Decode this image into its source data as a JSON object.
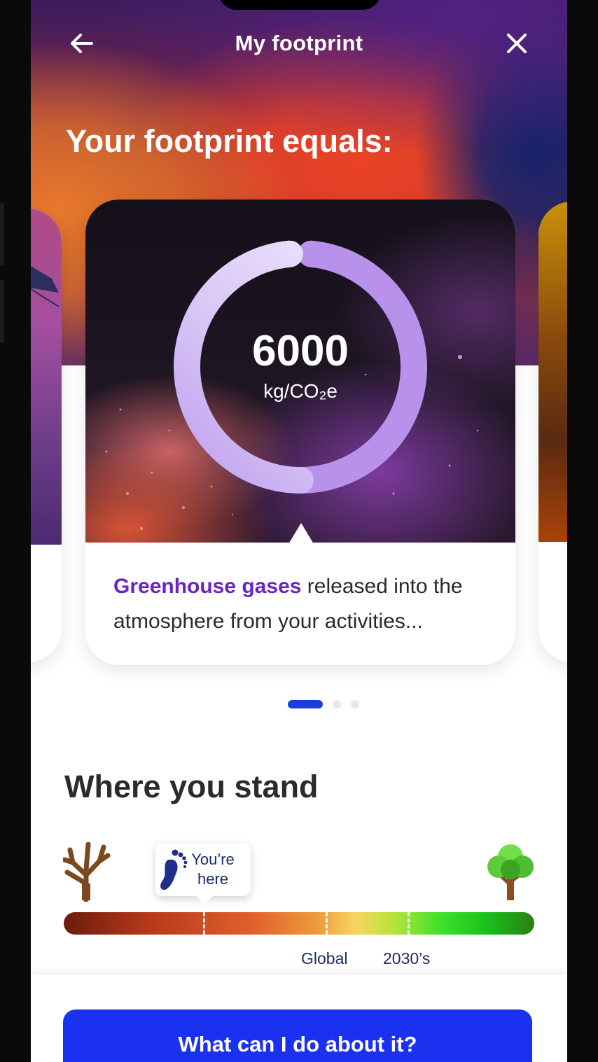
{
  "header": {
    "title": "My footprint",
    "back_icon": "arrow-left-icon",
    "close_icon": "close-icon"
  },
  "hero": {
    "title": "Your footprint equals:"
  },
  "carousel": {
    "active_index": 0,
    "page_count": 3,
    "main_card": {
      "value": "6000",
      "unit": "kg/CO₂e",
      "ring_fill_fraction": 0.97,
      "highlight_text": "Greenhouse gases",
      "body_text": " released into the atmosphere from your activities..."
    }
  },
  "where_you_stand": {
    "title": "Where you stand",
    "marker_label_line1": "You’re",
    "marker_label_line2": "here",
    "marker_icon": "footprint-icon",
    "left_icon": "bare-tree-icon",
    "right_icon": "green-tree-icon",
    "global_label": "Global",
    "target_label": "2030’s"
  },
  "cta": {
    "label": "What can I do about it?"
  },
  "colors": {
    "accent_blue": "#1b31f0",
    "highlight_purple": "#6a25c2",
    "ring_purple": "#b892ea"
  }
}
